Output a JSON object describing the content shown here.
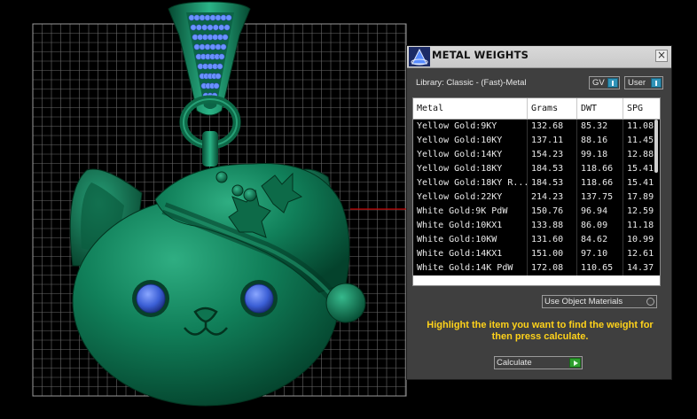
{
  "panel": {
    "title": "METAL WEIGHTS",
    "close_glyph": "×",
    "library_label": "Library: Classic - (Fast)-Metal",
    "toggles": [
      {
        "label": "GV",
        "state": "on"
      },
      {
        "label": "User",
        "state": "on"
      }
    ],
    "use_object_label": "Use Object Materials",
    "hint": "Highlight the item you want to find the weight for then press calculate.",
    "calculate_label": "Calculate"
  },
  "table": {
    "columns": [
      "Metal",
      "Grams",
      "DWT",
      "SPG"
    ],
    "rows": [
      [
        "Yellow Gold:9KY",
        "132.68",
        "85.32",
        "11.08"
      ],
      [
        "Yellow Gold:10KY",
        "137.11",
        "88.16",
        "11.45"
      ],
      [
        "Yellow Gold:14KY",
        "154.23",
        "99.18",
        "12.88"
      ],
      [
        "Yellow Gold:18KY",
        "184.53",
        "118.66",
        "15.41"
      ],
      [
        "Yellow Gold:18KY R...",
        "184.53",
        "118.66",
        "15.41"
      ],
      [
        "Yellow Gold:22KY",
        "214.23",
        "137.75",
        "17.89"
      ],
      [
        "White Gold:9K PdW",
        "150.76",
        "96.94",
        "12.59"
      ],
      [
        "White Gold:10KX1",
        "133.88",
        "86.09",
        "11.18"
      ],
      [
        "White Gold:10KW",
        "131.60",
        "84.62",
        "10.99"
      ],
      [
        "White Gold:14KX1",
        "151.00",
        "97.10",
        "12.61"
      ],
      [
        "White Gold:14K PdW",
        "172.08",
        "110.65",
        "14.37"
      ]
    ]
  },
  "colors": {
    "model": "#0f7a55",
    "gem": "#3b5fd6",
    "grid": "#6a6a6a",
    "axis": "#c00000",
    "hint": "#ffd21a",
    "toggle": "#2f93b8",
    "go": "#2fa02f"
  },
  "icons": {
    "panel_logo": "metal-weights-logo-icon",
    "close": "close-icon",
    "toggle_knob": "toggle-knob-icon",
    "radio": "radio-icon",
    "go": "play-arrow-icon"
  }
}
